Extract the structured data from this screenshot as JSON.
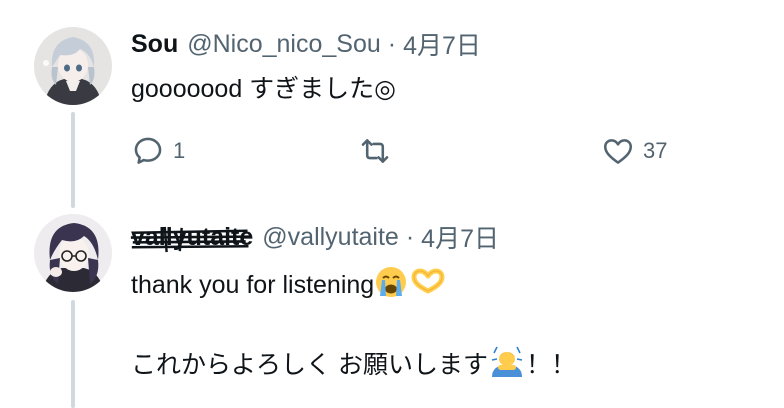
{
  "tweets": [
    {
      "display_name": "Sou",
      "handle": "@Nico_nico_Sou",
      "separator": "·",
      "date": "4月7日",
      "text": "gooooood すぎました◎",
      "reply_count": "1",
      "retweet_count": "",
      "like_count": "37"
    },
    {
      "display_name": "vallyutaite",
      "handle": "@vallyutaite",
      "separator": "·",
      "date": "4月7日",
      "text_line1": "thank you for listening",
      "text_line2_main": "これからよろしく お願いします",
      "text_line2_tail": "！！"
    }
  ],
  "icons": {
    "reply": "speech-bubble-icon",
    "retweet": "retweet-arrows-icon",
    "like": "heart-icon",
    "emoji_1": "crying-face-emoji",
    "emoji_2": "heart-hands-emoji",
    "emoji_3": "bowing-person-emoji"
  },
  "colors": {
    "text": "#0f1419",
    "secondary": "#536471",
    "thread_line": "#cfd9de"
  }
}
